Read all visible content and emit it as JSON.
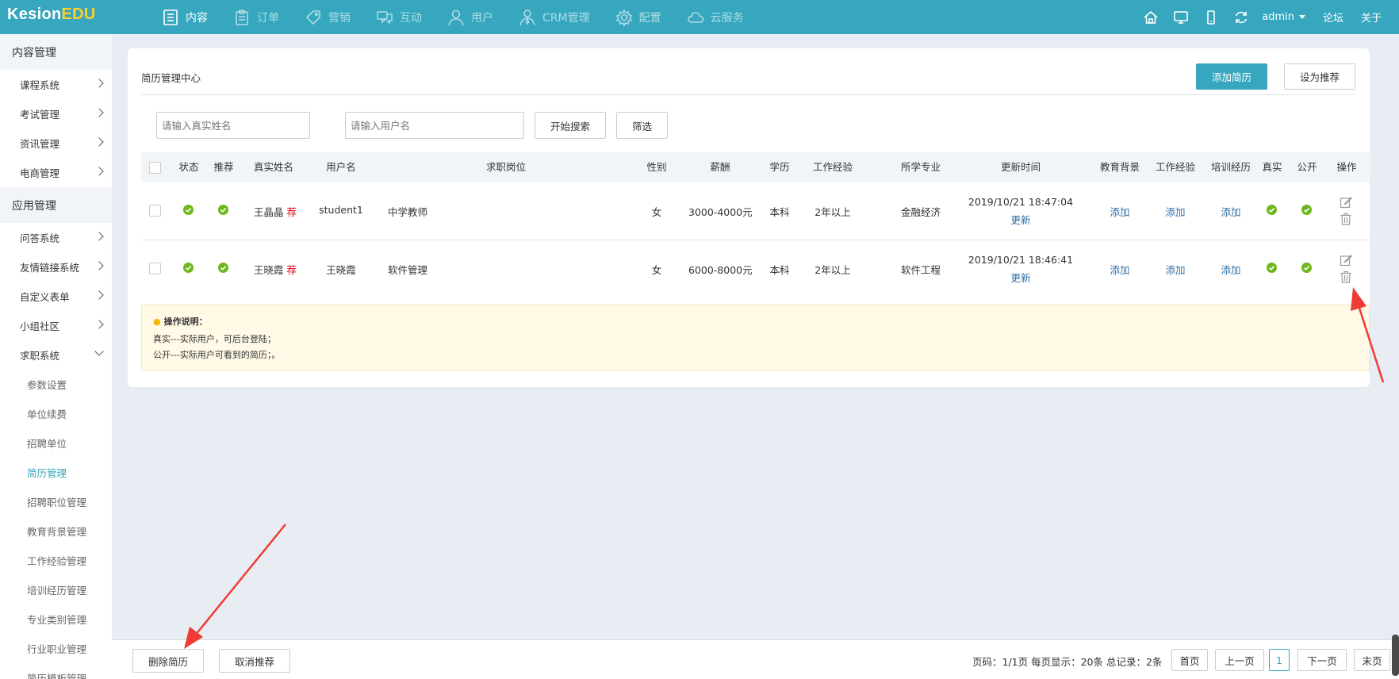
{
  "app": {
    "logo_a": "Kesion",
    "logo_b": "EDU"
  },
  "nav": [
    {
      "label": "内容",
      "icon": "document-icon",
      "active": true
    },
    {
      "label": "订单",
      "icon": "clipboard-icon"
    },
    {
      "label": "营销",
      "icon": "tag-icon"
    },
    {
      "label": "互动",
      "icon": "chat-icon"
    },
    {
      "label": "用户",
      "icon": "user-icon"
    },
    {
      "label": "CRM管理",
      "icon": "user-tie-icon"
    },
    {
      "label": "配置",
      "icon": "gear-icon"
    },
    {
      "label": "云服务",
      "icon": "cloud-icon"
    }
  ],
  "topright": {
    "user": "admin",
    "forum": "论坛",
    "about": "关于"
  },
  "sidebar": {
    "group1": "内容管理",
    "group1_items": [
      "课程系统",
      "考试管理",
      "资讯管理",
      "电商管理"
    ],
    "group2": "应用管理",
    "group2_items": [
      "问答系统",
      "友情链接系统",
      "自定义表单",
      "小组社区",
      "求职系统"
    ],
    "sub_items": [
      "参数设置",
      "单位续费",
      "招聘单位",
      "简历管理",
      "招聘职位管理",
      "教育背景管理",
      "工作经验管理",
      "培训经历管理",
      "专业类别管理",
      "行业职业管理",
      "简历模板管理"
    ]
  },
  "card": {
    "title": "简历管理中心",
    "add_btn": "添加简历",
    "recommend_btn": "设为推荐",
    "name_placeholder": "请输入真实姓名",
    "user_placeholder": "请输入用户名",
    "search_btn": "开始搜索",
    "filter_btn": "筛选"
  },
  "table": {
    "headers": [
      "状态",
      "推荐",
      "真实姓名",
      "用户名",
      "求职岗位",
      "性别",
      "薪酬",
      "学历",
      "工作经验",
      "所学专业",
      "更新时间",
      "教育背景",
      "工作经验",
      "培训经历",
      "真实",
      "公开",
      "操作"
    ],
    "rows": [
      {
        "name": "王晶晶",
        "rec": "荐",
        "username": "student1",
        "position": "中学教师",
        "gender": "女",
        "salary": "3000-4000元",
        "education": "本科",
        "experience": "2年以上",
        "major": "金融经济",
        "time": "2019/10/21 18:47:04",
        "update": "更新",
        "edu_bg": "添加",
        "work_exp": "添加",
        "training": "添加"
      },
      {
        "name": "王晓霞",
        "rec": "荐",
        "username": "王晓霞",
        "position": "软件管理",
        "gender": "女",
        "salary": "6000-8000元",
        "education": "本科",
        "experience": "2年以上",
        "major": "软件工程",
        "time": "2019/10/21 18:46:41",
        "update": "更新",
        "edu_bg": "添加",
        "work_exp": "添加",
        "training": "添加"
      }
    ]
  },
  "notice": {
    "title": "操作说明：",
    "line1": "真实---实际用户，可后台登陆；",
    "line2": "公开---实际用户可看到的简历；。"
  },
  "bottom": {
    "delete_btn": "删除简历",
    "cancel_rec_btn": "取消推荐",
    "pager_info": "页码：1/1页 每页显示：20条 总记录：2条",
    "first": "首页",
    "prev": "上一页",
    "current": "1",
    "next": "下一页",
    "last": "末页"
  },
  "colors": {
    "accent": "#36a7be",
    "ok": "#6cb81d",
    "recommend": "#e60012",
    "annotation": "#ef3b36"
  }
}
